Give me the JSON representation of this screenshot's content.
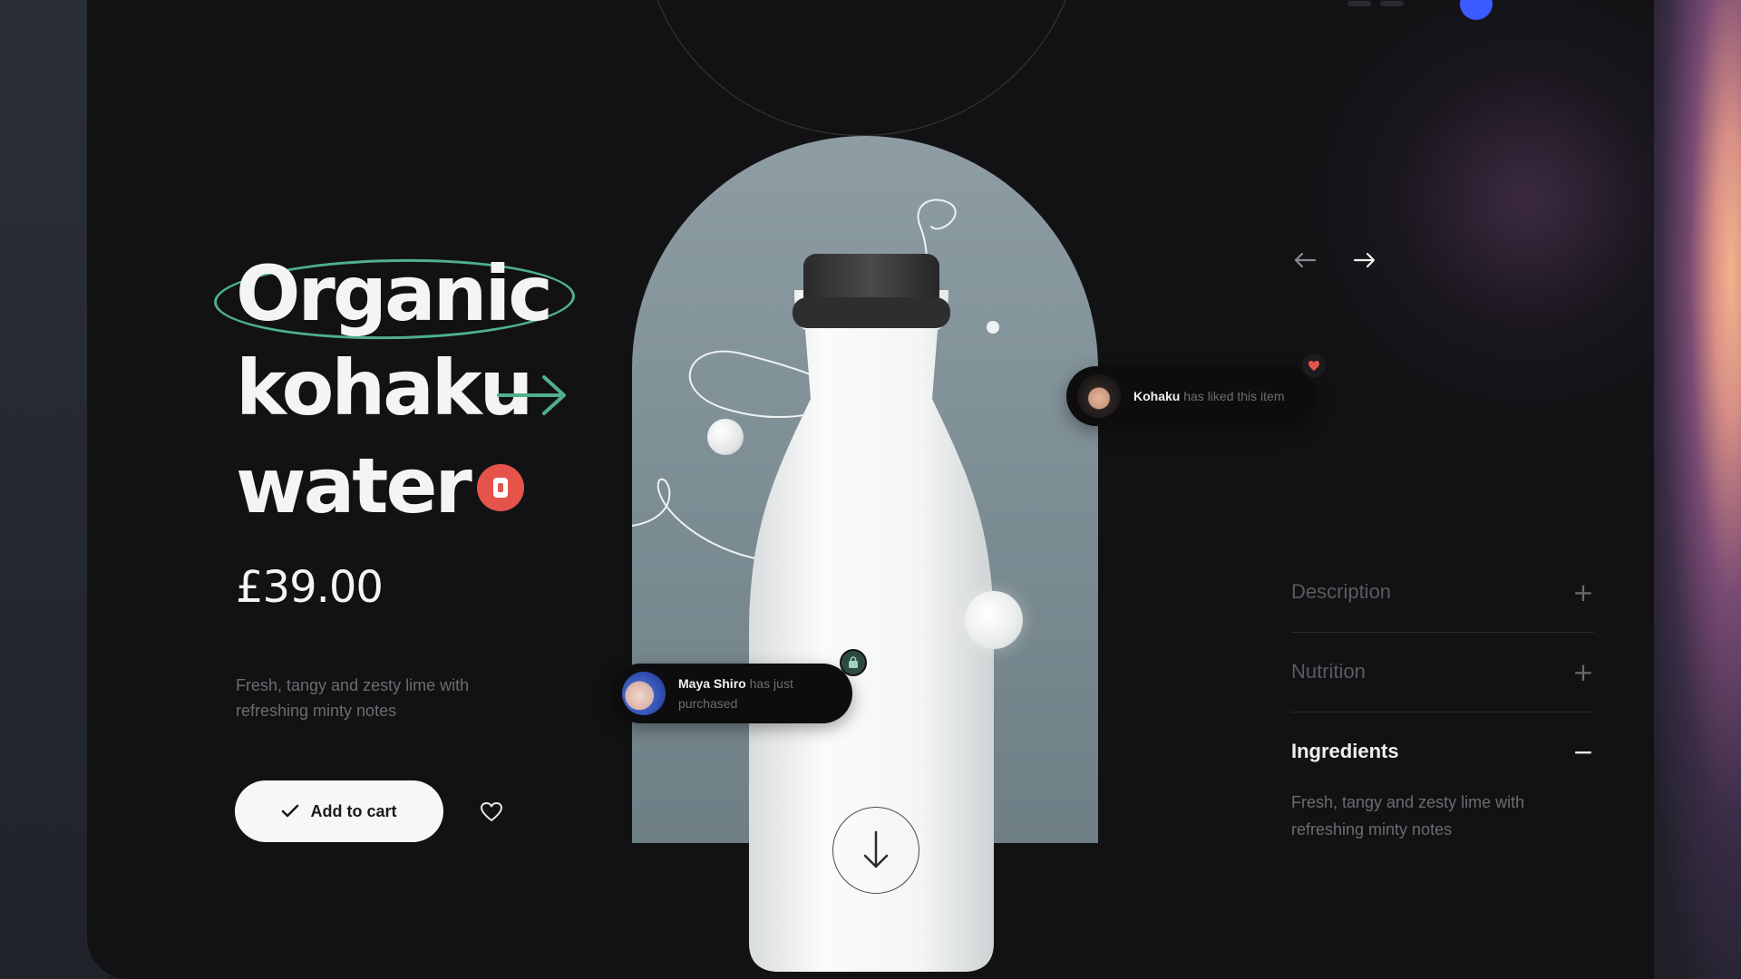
{
  "product": {
    "title_line_1": "Organic",
    "title_line_2": "kohaku",
    "title_line_3": "water",
    "price": "£39.00",
    "tagline": "Fresh, tangy and zesty lime with refreshing minty notes",
    "add_to_cart_label": "Add to cart"
  },
  "notifications": {
    "purchase": {
      "name": "Maya Shiro",
      "text": "has just purchased",
      "icon": "shopping-bag-icon"
    },
    "like": {
      "name": "Kohaku",
      "text": "has liked this item",
      "icon": "heart-icon"
    }
  },
  "accordion": {
    "items": [
      {
        "label": "Description",
        "sign": "+",
        "expanded": false
      },
      {
        "label": "Nutrition",
        "sign": "+",
        "expanded": false
      },
      {
        "label": "Ingredients",
        "sign": "−",
        "expanded": true
      }
    ],
    "ingredients_text": "Fresh, tangy and zesty lime with refreshing minty notes"
  },
  "icons": {
    "prev": "arrow-left-icon",
    "next": "arrow-right-icon",
    "scroll": "arrow-down-icon",
    "wishlist": "heart-outline-icon",
    "cart_check": "checkmark-icon"
  },
  "colors": {
    "background": "#121214",
    "accent_green": "#4fb08c",
    "accent_red": "#e5534b",
    "arch": "#7b8c93",
    "text_primary": "#f4f4f2",
    "text_muted": "#6c6c70"
  }
}
